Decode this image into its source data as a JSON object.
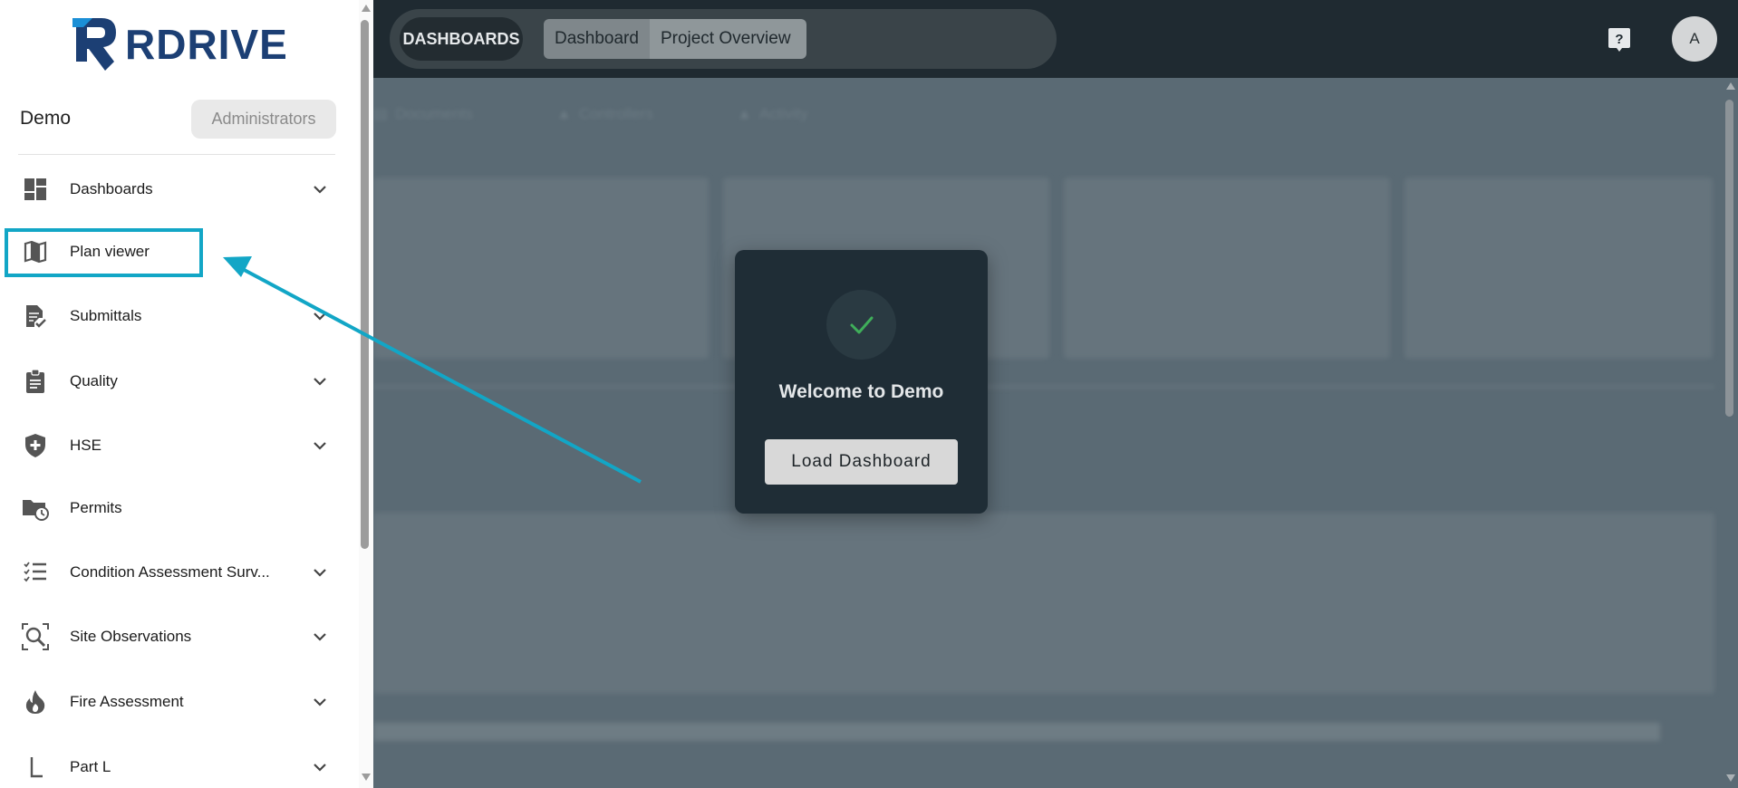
{
  "topbar": {
    "section_label": "DASHBOARDS",
    "tabs": [
      "Dashboard",
      "Project Overview"
    ],
    "avatar_initial": "A"
  },
  "background": {
    "tabs": [
      "Documents",
      "Controllers",
      "Activity"
    ]
  },
  "modal": {
    "title": "Welcome to Demo",
    "button_label": "Load Dashboard"
  },
  "sidebar": {
    "logo_text": "RDRIVE",
    "org_name": "Demo",
    "role_badge": "Administrators",
    "items": [
      {
        "label": "Dashboards",
        "icon": "dashboard-icon",
        "expandable": true
      },
      {
        "label": "Plan viewer",
        "icon": "map-icon",
        "expandable": false
      },
      {
        "label": "Submittals",
        "icon": "document-check-icon",
        "expandable": true
      },
      {
        "label": "Quality",
        "icon": "clipboard-icon",
        "expandable": true
      },
      {
        "label": "HSE",
        "icon": "shield-plus-icon",
        "expandable": true
      },
      {
        "label": "Permits",
        "icon": "folder-clock-icon",
        "expandable": false
      },
      {
        "label": "Condition Assessment Surv...",
        "icon": "checklist-icon",
        "expandable": true
      },
      {
        "label": "Site Observations",
        "icon": "search-scan-icon",
        "expandable": true
      },
      {
        "label": "Fire Assessment",
        "icon": "fire-icon",
        "expandable": true
      },
      {
        "label": "Part L",
        "icon": "letter-l-icon",
        "expandable": true
      }
    ]
  },
  "colors": {
    "highlight": "#12a6c6",
    "topbar": "#1f2a31",
    "brand": "#1c3f74",
    "success": "#3fae5a"
  }
}
